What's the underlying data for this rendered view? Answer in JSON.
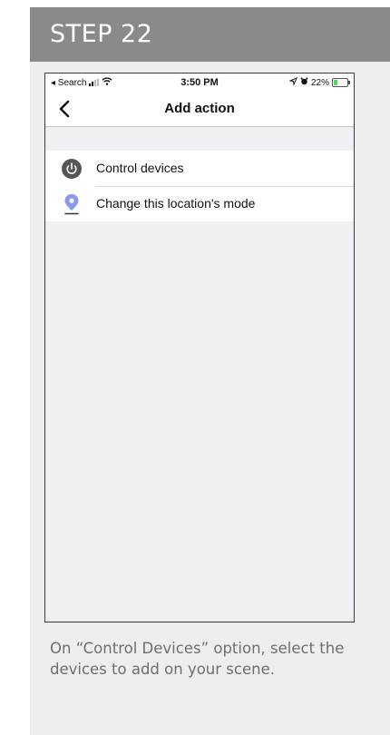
{
  "step": {
    "title": "STEP 22"
  },
  "status_bar": {
    "back_app": "◂ Search",
    "time": "3:50 PM",
    "battery_percent": "22%",
    "icons": [
      "signal-icon",
      "wifi-icon",
      "location-arrow-icon",
      "alarm-icon",
      "battery-charging-icon"
    ]
  },
  "nav": {
    "title": "Add action",
    "back_icon": "chevron-left-icon"
  },
  "actions": [
    {
      "label": "Control devices",
      "icon": "power-icon"
    },
    {
      "label": "Change this location's mode",
      "icon": "location-pin-icon"
    }
  ],
  "caption": {
    "text": "On “Control Devices” option, select the devices to add on your scene."
  },
  "colors": {
    "header_bg": "#8a8a8c",
    "card_bg": "#efeeee",
    "power_icon": "#555555",
    "pin_icon": "#8a98f0",
    "battery_fill": "#4cd964"
  }
}
